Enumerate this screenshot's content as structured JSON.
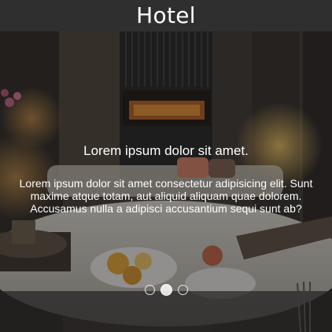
{
  "header": {
    "title": "Hotel"
  },
  "slider": {
    "active_slide": 2,
    "slide_count": 3,
    "slides": [
      {
        "image": "hotel-room-dining-photo",
        "title": "Lorem ipsum dolor sit amet.",
        "text_lines": [
          "Lorem ipsum dolor sit amet consectetur adipisicing elit. Sunt",
          "maxime atque totam, aut aliquid aliquam quae dolorem.",
          "Accusamus nulla a adipisci accusantium sequi sunt ab?"
        ]
      }
    ]
  }
}
